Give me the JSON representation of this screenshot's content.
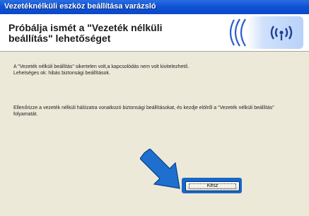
{
  "window": {
    "title": "Vezetéknélküli eszköz beállítása varázsló"
  },
  "header": {
    "heading": "Próbálja ismét a \"Vezeték nélküli beállítás\" lehetőséget",
    "logo_icon": "wireless-signal-icon"
  },
  "content": {
    "message_line1": "A \"Vezeték nélküli beállítás\" sikertelen volt,a kapcsolódás nem volt kivitelezhető.",
    "message_line2": "Lehetséges ok: hibás biztonsági beállítások.",
    "instruction": "Ellenőrizze a vezeték nélküli hálózatra vonatkozó biztonsági beállításokat, és kezdje elölről a \"Vezeték nélküli beállítás\" folyamatát."
  },
  "footer": {
    "finish_label": "Kész",
    "pointer_icon": "arrow-pointer-icon"
  },
  "colors": {
    "titlebar": "#0f54d6",
    "highlight": "#1a66c9",
    "logo_blue": "#2a5fcf"
  }
}
